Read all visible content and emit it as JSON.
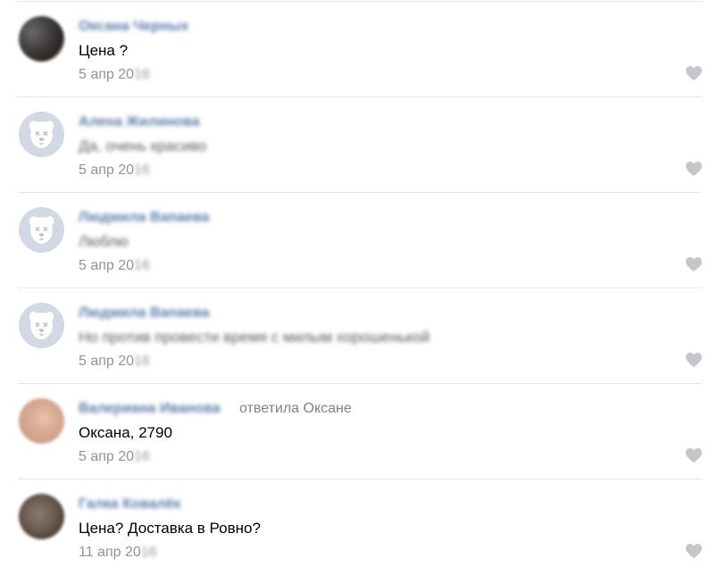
{
  "comments": [
    {
      "author": "Оксана Черных",
      "text": "Цена ?",
      "date_visible": "5 апр 20",
      "date_blurred": "16",
      "avatar": "photo",
      "text_blurred": false
    },
    {
      "author": "Алена Жилинова",
      "text": "Да, очень красиво",
      "date_visible": "5 апр 20",
      "date_blurred": "16",
      "avatar": "deactivated-dog",
      "text_blurred": true
    },
    {
      "author": "Людмила Вапаева",
      "text": "Люблю",
      "date_visible": "5 апр 20",
      "date_blurred": "16",
      "avatar": "deactivated-dog",
      "text_blurred": true
    },
    {
      "author": "Людмила Вапаева",
      "text": "Но против провести время с милым хорошенькой",
      "date_visible": "5 апр 20",
      "date_blurred": "16",
      "avatar": "deactivated-dog",
      "text_blurred": true
    },
    {
      "author": "Валериана Иванова",
      "reply_to": "ответила Оксане",
      "text": "Оксана, 2790",
      "date_visible": "5 апр 20",
      "date_blurred": "16",
      "avatar": "photo",
      "text_blurred": false
    },
    {
      "author": "Галка Ковалёк",
      "text": "Цена? Доставка в Ровно?",
      "date_visible": "11 апр 20",
      "date_blurred": "16",
      "avatar": "photo",
      "text_blurred": false
    }
  ],
  "icons": {
    "like": "heart-icon",
    "deactivated_avatar": "deactivated-dog-icon"
  },
  "colors": {
    "author_link": "#5b7ca7",
    "meta_text": "#939393",
    "like_icon": "#c4c6c9",
    "divider": "#e4e6ea",
    "deactivated_avatar_bg": "#d2d9e3"
  }
}
